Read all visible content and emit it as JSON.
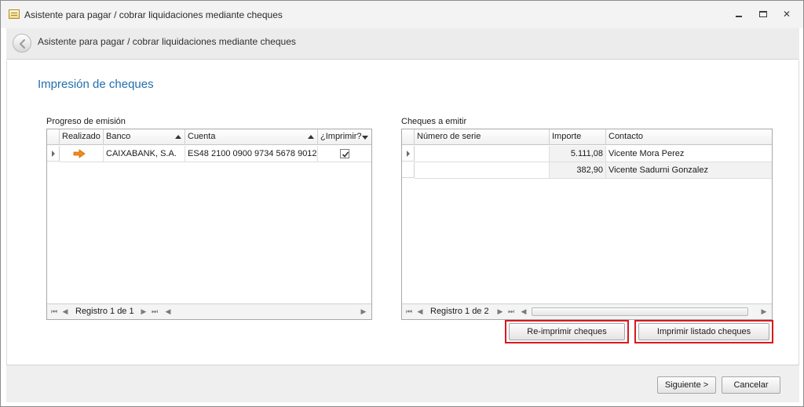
{
  "window": {
    "title": "Asistente para pagar / cobrar liquidaciones mediante cheques",
    "controls": {
      "minimize": "minimize",
      "maximize": "maximize",
      "close": "✕"
    }
  },
  "header": {
    "title": "Asistente para pagar / cobrar liquidaciones mediante cheques"
  },
  "page": {
    "title": "Impresión de cheques"
  },
  "progress": {
    "label": "Progreso de emisión",
    "columns": [
      "Realizado",
      "Banco",
      "Cuenta",
      "¿Imprimir?"
    ],
    "rows": [
      {
        "realizado_icon": "arrow-right-icon",
        "banco": "CAIXABANK, S.A.",
        "cuenta": "ES48 2100 0900 9734 5678 9012",
        "imprimir": true
      }
    ],
    "nav": {
      "record_text": "Registro 1 de 1"
    }
  },
  "cheques": {
    "label": "Cheques a emitir",
    "columns": [
      "Número de serie",
      "Importe",
      "Contacto"
    ],
    "rows": [
      {
        "numero_serie": "",
        "importe": "5.111,08",
        "contacto": "Vicente Mora Perez"
      },
      {
        "numero_serie": "",
        "importe": "382,90",
        "contacto": "Vicente Sadurni Gonzalez"
      }
    ],
    "nav": {
      "record_text": "Registro 1 de 2"
    }
  },
  "actions": {
    "reprint": "Re-imprimir cheques",
    "print_list": "Imprimir listado cheques"
  },
  "footer": {
    "next": "Siguiente >",
    "cancel": "Cancelar"
  },
  "colors": {
    "accent_title": "#1f6fae",
    "highlight_frame": "#d9181e",
    "arrow_icon": "#f08c1a"
  }
}
